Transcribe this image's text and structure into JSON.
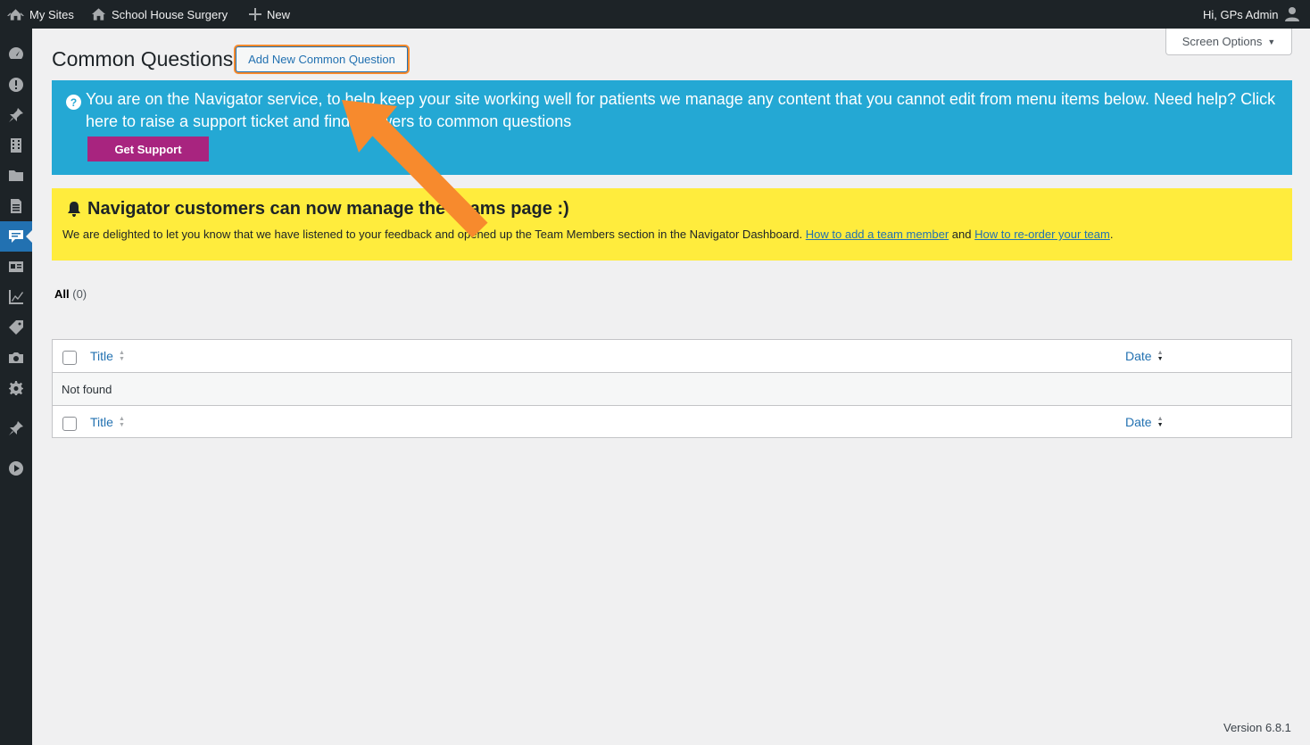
{
  "adminbar": {
    "my_sites": "My Sites",
    "site_name": "School House Surgery",
    "new": "New",
    "greeting": "Hi, GPs Admin"
  },
  "sidebar": {
    "icons": [
      "dashboard-icon",
      "alert-icon",
      "pin-icon",
      "building-icon",
      "folder-icon",
      "page-icon",
      "comment-icon",
      "id-card-icon",
      "chart-icon",
      "tag-icon",
      "camera-icon",
      "gear-icon",
      "pin-icon-2",
      "play-icon"
    ],
    "active": "comment-icon"
  },
  "header": {
    "title": "Common Questions",
    "add_new_label": "Add New Common Question",
    "screen_options": "Screen Options"
  },
  "blue_notice": {
    "text": "You are on the Navigator service, to help keep your site working well for patients we manage any content that you cannot edit from menu items below. Need help? Click here to raise a support ticket and find answers to common questions",
    "button": "Get Support",
    "color": "#24a8d4",
    "button_color": "#a8247f"
  },
  "yellow_notice": {
    "title": "Navigator customers can now manage the Teams page :)",
    "text_before": "We are delighted to let you know that we have listened to your feedback and opened up the Team Members section in the Navigator Dashboard.",
    "link1": "How to add a team member",
    "text_and": "and",
    "link2": "How to re-order your team",
    "text_after": ".",
    "color": "#ffec3d"
  },
  "filters": {
    "all_label": "All",
    "all_count": "(0)"
  },
  "table": {
    "col_title": "Title",
    "col_date": "Date",
    "empty": "Not found"
  },
  "footer": {
    "version": "Version 6.8.1"
  },
  "overlay": {
    "arrow_color": "#f78a2d"
  }
}
